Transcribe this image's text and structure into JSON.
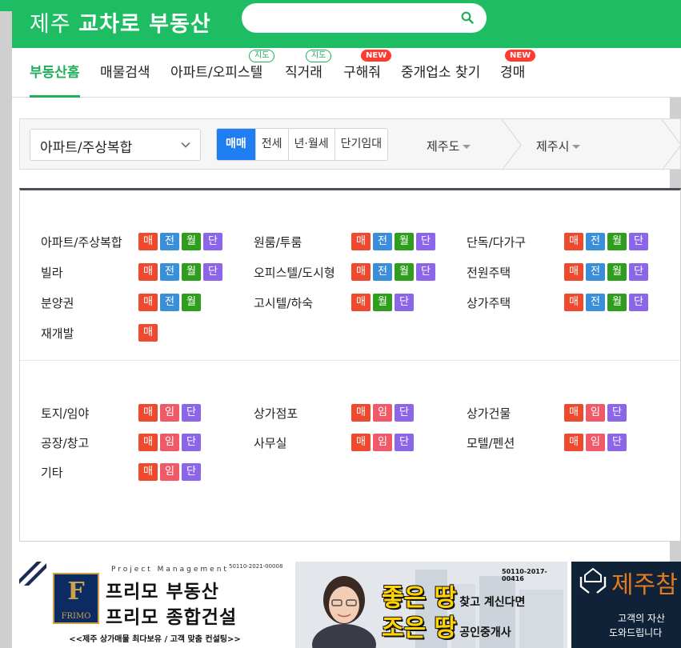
{
  "header": {
    "logo_regular": "제주 ",
    "logo_bold": "교차로 부동산",
    "search_placeholder": ""
  },
  "nav": {
    "items": [
      {
        "label": "부동산홈",
        "active": true
      },
      {
        "label": "매물검색"
      },
      {
        "label": "아파트/오피스텔",
        "badge": "지도"
      },
      {
        "label": "직거래",
        "badge": "지도"
      },
      {
        "label": "구해줘",
        "badge": "NEW"
      },
      {
        "label": "중개업소 찾기"
      },
      {
        "label": "경매",
        "badge": "NEW"
      }
    ]
  },
  "filter": {
    "property_type": "아파트/주상복합",
    "deal_tabs": [
      "매매",
      "전세",
      "년·월세",
      "단기임대"
    ],
    "active_deal": "매매",
    "region1": "제주도",
    "region2": "제주시"
  },
  "categories_residential": [
    {
      "name": "아파트/주상복합",
      "tags": [
        "매",
        "전",
        "월",
        "단"
      ]
    },
    {
      "name": "원룸/투룸",
      "tags": [
        "매",
        "전",
        "월",
        "단"
      ]
    },
    {
      "name": "단독/다가구",
      "tags": [
        "매",
        "전",
        "월",
        "단"
      ]
    },
    {
      "name": "빌라",
      "tags": [
        "매",
        "전",
        "월",
        "단"
      ]
    },
    {
      "name": "오피스텔/도시형",
      "tags": [
        "매",
        "전",
        "월",
        "단"
      ]
    },
    {
      "name": "전원주택",
      "tags": [
        "매",
        "전",
        "월",
        "단"
      ]
    },
    {
      "name": "분양권",
      "tags": [
        "매",
        "전",
        "월"
      ]
    },
    {
      "name": "고시텔/하숙",
      "tags": [
        "매",
        "월",
        "단"
      ]
    },
    {
      "name": "상가주택",
      "tags": [
        "매",
        "전",
        "월",
        "단"
      ]
    },
    {
      "name": "재개발",
      "tags": [
        "매"
      ]
    }
  ],
  "categories_commercial": [
    {
      "name": "토지/임야",
      "tags": [
        "매",
        "임",
        "단"
      ]
    },
    {
      "name": "상가점포",
      "tags": [
        "매",
        "임",
        "단"
      ]
    },
    {
      "name": "상가건물",
      "tags": [
        "매",
        "임",
        "단"
      ]
    },
    {
      "name": "공장/창고",
      "tags": [
        "매",
        "임",
        "단"
      ]
    },
    {
      "name": "사무실",
      "tags": [
        "매",
        "임",
        "단"
      ]
    },
    {
      "name": "모텔/펜션",
      "tags": [
        "매",
        "임",
        "단"
      ]
    },
    {
      "name": "기타",
      "tags": [
        "매",
        "임",
        "단"
      ]
    }
  ],
  "tag_colors": {
    "매": "#ef4a2e",
    "전": "#3b8fd9",
    "월": "#2f9e1e",
    "단": "#8c66e8",
    "임": "#f05a68"
  },
  "banners": {
    "frimo": {
      "subtitle": "Project Management",
      "reg": "50110-2021-00008",
      "logo": "FRIMO",
      "line1": "프리모 부동산",
      "line2": "프리모 종합건설",
      "footer": "<<제주 상가매물 최다보유 / 고객 맞춤 컨설팅>>"
    },
    "joeunttang": {
      "reg": "50110-2017-00416",
      "big1": "좋은 땅",
      "small1": "찾고 계신다면",
      "big2": "조은 땅",
      "small2": "공인중개사"
    },
    "jeju": {
      "title": "제주참",
      "line1": "고객의 자산",
      "line2": "도와드립니다"
    }
  }
}
